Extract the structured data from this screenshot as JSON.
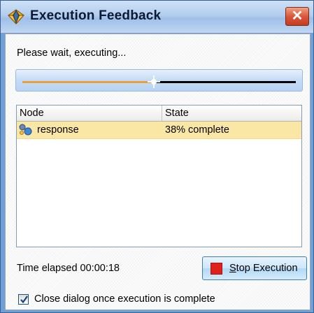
{
  "window": {
    "title": "Execution Feedback",
    "close_label": "✕"
  },
  "status": {
    "message": "Please wait, executing...",
    "progress_fraction": 0.48
  },
  "table": {
    "columns": [
      "Node",
      "State"
    ],
    "rows": [
      {
        "node": "response",
        "state": "38% complete",
        "icon": "model-nugget-icon",
        "selected": true
      }
    ]
  },
  "footer": {
    "elapsed_label": "Time elapsed 00:00:18",
    "stop_label_hotkey": "S",
    "stop_label_rest": "top Execution",
    "checkbox_label": "Close dialog once execution is complete",
    "checkbox_checked": true
  },
  "colors": {
    "progress_fill": "#e8a03a",
    "selected_row": "#fbe7a5",
    "stop_icon": "#e0201a"
  }
}
